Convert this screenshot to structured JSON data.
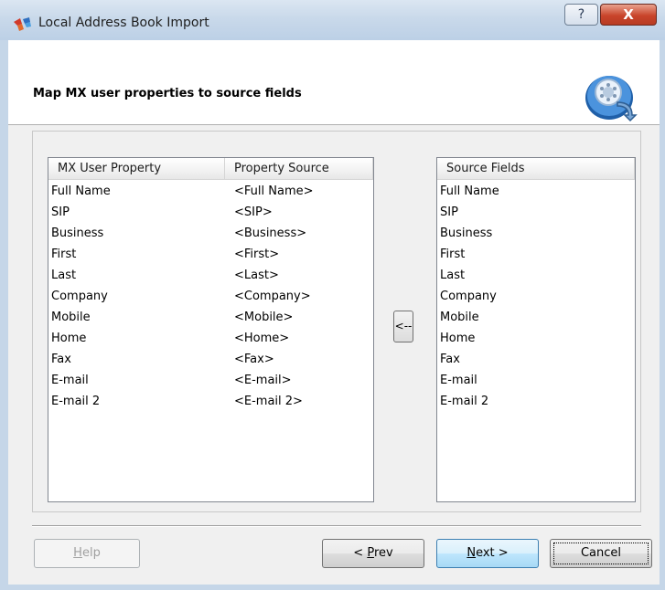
{
  "window": {
    "title": "Local Address Book Import",
    "help_glyph": "?",
    "close_glyph": "X"
  },
  "header": {
    "title": "Map MX user properties to source fields",
    "icon": "address-book-import-icon"
  },
  "mapping_list": {
    "columns": [
      "MX User Property",
      "Property Source"
    ],
    "rows": [
      [
        "Full Name",
        "<Full Name>"
      ],
      [
        "SIP",
        "<SIP>"
      ],
      [
        "Business",
        "<Business>"
      ],
      [
        "First",
        "<First>"
      ],
      [
        "Last",
        "<Last>"
      ],
      [
        "Company",
        "<Company>"
      ],
      [
        "Mobile",
        "<Mobile>"
      ],
      [
        "Home",
        "<Home>"
      ],
      [
        "Fax",
        "<Fax>"
      ],
      [
        "E-mail",
        "<E-mail>"
      ],
      [
        "E-mail 2",
        "<E-mail 2>"
      ]
    ]
  },
  "assign_button": {
    "label": "<--"
  },
  "source_list": {
    "column": "Source Fields",
    "items": [
      "Full Name",
      "SIP",
      "Business",
      "First",
      "Last",
      "Company",
      "Mobile",
      "Home",
      "Fax",
      "E-mail",
      "E-mail 2"
    ]
  },
  "buttons": {
    "help": {
      "mnemonic": "H",
      "rest": "elp"
    },
    "prev": {
      "prefix": "< ",
      "mnemonic": "P",
      "rest": "rev"
    },
    "next": {
      "mnemonic": "N",
      "rest": "ext >"
    },
    "cancel": "Cancel"
  },
  "colors": {
    "titlebar": "#c9d9ea",
    "close_button": "#c9452b",
    "default_button_border": "#3c7fb1"
  }
}
